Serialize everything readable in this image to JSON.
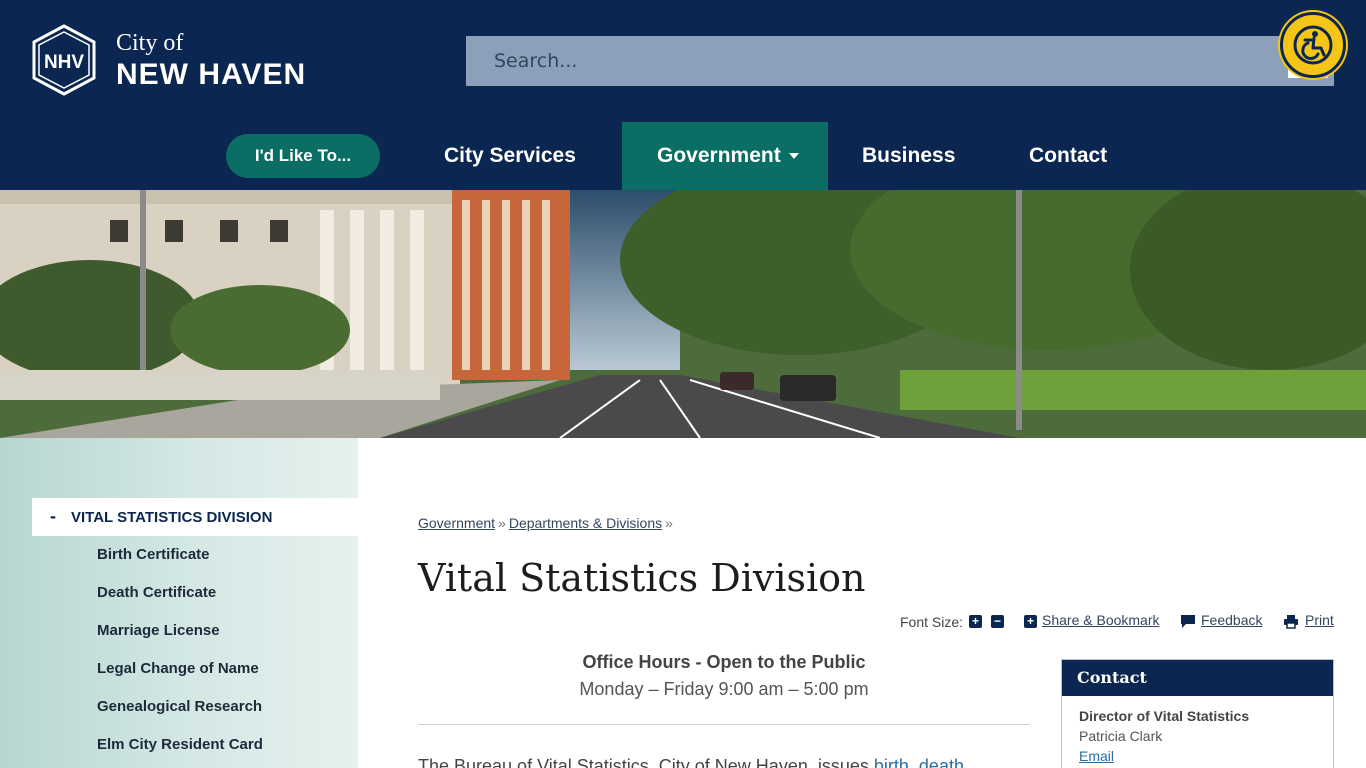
{
  "header": {
    "logo_city": "City of",
    "logo_name": "NEW HAVEN",
    "logo_badge_text": "NHV",
    "search_placeholder": "Search..."
  },
  "nav": {
    "pill": "I'd Like To...",
    "items": [
      "City Services",
      "Government",
      "Business",
      "Contact"
    ],
    "active": "Government"
  },
  "sidebar": {
    "active_label": "VITAL STATISTICS DIVISION",
    "active_toggle": "-",
    "items": [
      "Birth Certificate",
      "Death Certificate",
      "Marriage License",
      "Legal Change of Name",
      "Genealogical Research",
      "Elm City Resident Card"
    ]
  },
  "breadcrumb": {
    "items": [
      "Government",
      "Departments & Divisions"
    ],
    "separator": "»"
  },
  "page": {
    "title": "Vital Statistics Division"
  },
  "tools": {
    "font_size_label": "Font Size:",
    "share": "Share & Bookmark",
    "feedback": "Feedback",
    "print": "Print"
  },
  "hours": {
    "title": "Office Hours - Open to the Public",
    "time": "Monday – Friday 9:00 am – 5:00 pm"
  },
  "intro": {
    "text": "The Bureau of Vital Statistics, City of New Haven, issues",
    "link1": "birth",
    "link2": "death"
  },
  "contact": {
    "heading": "Contact",
    "role": "Director of Vital Statistics",
    "name": "Patricia Clark",
    "email": "Email"
  },
  "colors": {
    "navy": "#0b2650",
    "teal": "#0a6e64",
    "search_bg": "#8da0b9",
    "accessibility_yellow": "#f5c518"
  }
}
